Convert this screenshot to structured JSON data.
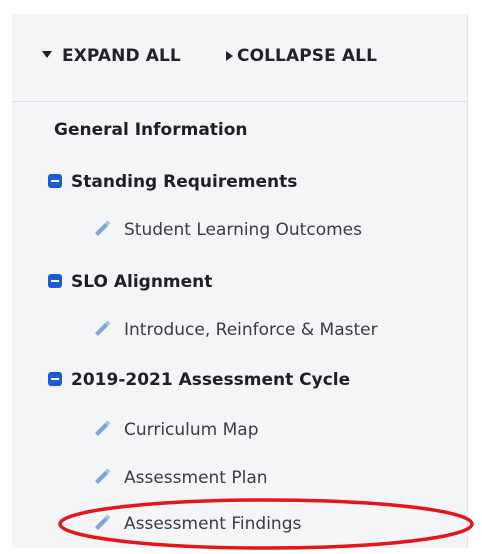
{
  "toolbar": {
    "expand_label": "EXPAND ALL",
    "collapse_label": "COLLAPSE ALL"
  },
  "nav": {
    "general": "General Information",
    "sections": [
      {
        "label": "Standing Requirements",
        "items": [
          "Student Learning Outcomes"
        ]
      },
      {
        "label": "SLO Alignment",
        "items": [
          "Introduce, Reinforce & Master"
        ]
      },
      {
        "label": "2019-2021 Assessment Cycle",
        "items": [
          "Curriculum Map",
          "Assessment Plan",
          "Assessment Findings"
        ]
      }
    ]
  },
  "colors": {
    "panel_bg": "#f4f5f7",
    "accent_blue": "#1a5bd6",
    "pencil_blue": "#7fa6d9",
    "annotation_red": "#e5161b"
  },
  "icons": {
    "expand": "triangle-down-icon",
    "collapse": "triangle-right-icon",
    "section_toggle": "minus-square-icon",
    "item": "pencil-icon"
  }
}
